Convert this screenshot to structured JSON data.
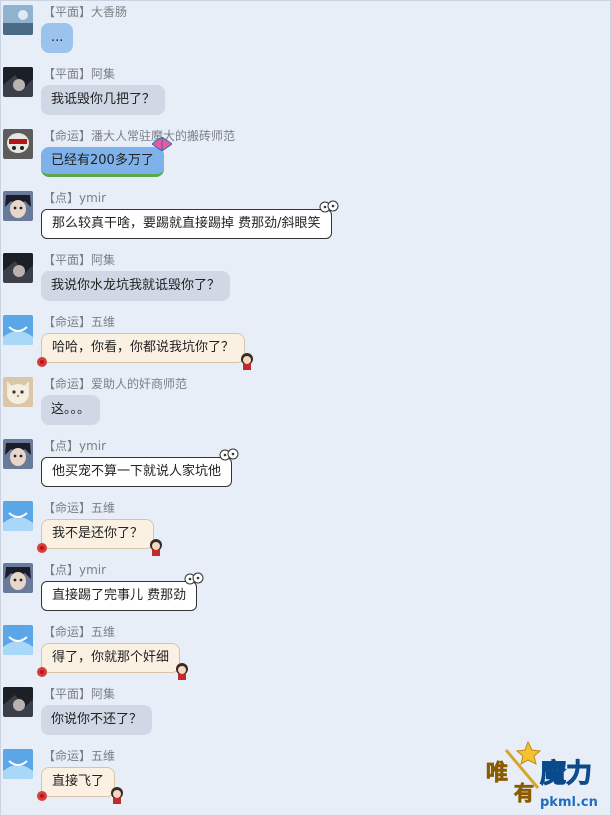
{
  "messages": [
    {
      "tag": "【平面】",
      "name": "大香肠",
      "text": "...",
      "bubble": "blue",
      "avatar": "avatar-sky"
    },
    {
      "tag": "【平面】",
      "name": "阿集",
      "text": "我诋毁你几把了？",
      "bubble": "gray",
      "avatar": "avatar-dark-hair"
    },
    {
      "tag": "【命运】",
      "name": "潘大人常驻魔大的搬砖师范",
      "text": "已经有200多万了",
      "bubble": "kite",
      "avatar": "avatar-skull-mask"
    },
    {
      "tag": "【点】",
      "name": "ymir",
      "text": "那么较真干啥，要踢就直接踢掉 费那劲/斜眼笑",
      "bubble": "white",
      "avatar": "avatar-anime-boy"
    },
    {
      "tag": "【平面】",
      "name": "阿集",
      "text": "我说你水龙坑我就诋毁你了？",
      "bubble": "gray",
      "avatar": "avatar-dark-hair"
    },
    {
      "tag": "【命运】",
      "name": "五维",
      "text": "哈哈，你看，你都说我坑你了？",
      "bubble": "cream",
      "avatar": "avatar-blue-smile"
    },
    {
      "tag": "【命运】",
      "name": "爱助人的奸商师范",
      "text": "这。。。",
      "bubble": "gray",
      "avatar": "avatar-cat"
    },
    {
      "tag": "【点】",
      "name": "ymir",
      "text": "他买宠不算一下就说人家坑他",
      "bubble": "white",
      "avatar": "avatar-anime-boy"
    },
    {
      "tag": "【命运】",
      "name": "五维",
      "text": "我不是还你了？",
      "bubble": "cream",
      "avatar": "avatar-blue-smile"
    },
    {
      "tag": "【点】",
      "name": "ymir",
      "text": "直接踢了完事儿 费那劲",
      "bubble": "white",
      "avatar": "avatar-anime-boy"
    },
    {
      "tag": "【命运】",
      "name": "五维",
      "text": "得了，你就那个奸细",
      "bubble": "cream",
      "avatar": "avatar-blue-smile"
    },
    {
      "tag": "【平面】",
      "name": "阿集",
      "text": "你说你不还了？",
      "bubble": "gray",
      "avatar": "avatar-dark-hair"
    },
    {
      "tag": "【命运】",
      "name": "五维",
      "text": "直接飞了",
      "bubble": "cream",
      "avatar": "avatar-blue-smile"
    }
  ],
  "watermark": {
    "text1": "唯",
    "text2": "有",
    "text3": "魔力",
    "url": "pkml.cn"
  }
}
